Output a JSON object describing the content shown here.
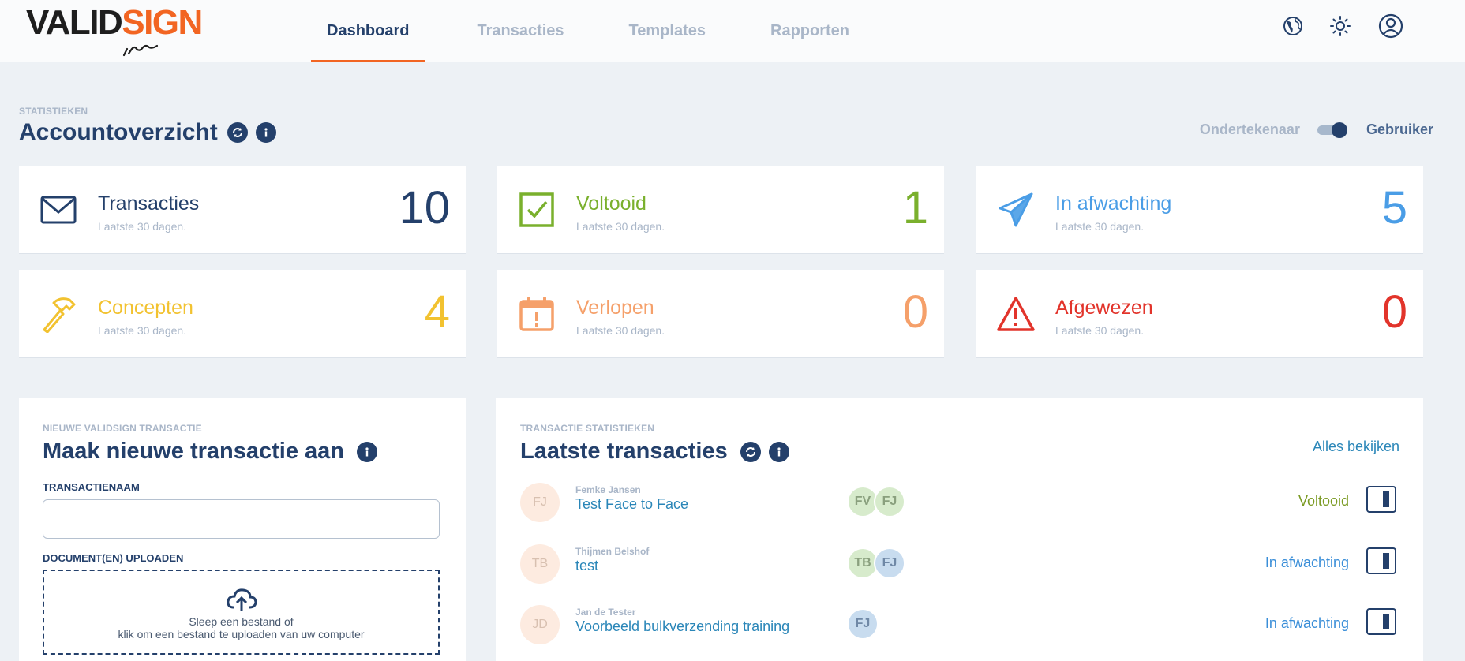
{
  "header": {
    "logo_left": "VALID",
    "logo_right": "SIGN",
    "tabs": [
      {
        "label": "Dashboard",
        "active": true
      },
      {
        "label": "Transacties",
        "active": false
      },
      {
        "label": "Templates",
        "active": false
      },
      {
        "label": "Rapporten",
        "active": false
      }
    ],
    "icons": [
      "globe-icon",
      "sun-icon",
      "user-icon"
    ]
  },
  "overview": {
    "eyebrow": "STATISTIEKEN",
    "title": "Accountoverzicht",
    "toggle": {
      "left_label": "Ondertekenaar",
      "right_label": "Gebruiker",
      "state": "right"
    }
  },
  "stats": [
    {
      "name": "Transacties",
      "sub": "Laatste 30 dagen.",
      "value": "10",
      "color": "#24406b",
      "icon": "envelope-icon"
    },
    {
      "name": "Voltooid",
      "sub": "Laatste 30 dagen.",
      "value": "1",
      "color": "#7ab02d",
      "icon": "checkbox-icon"
    },
    {
      "name": "In afwachting",
      "sub": "Laatste 30 dagen.",
      "value": "5",
      "color": "#4a9de6",
      "icon": "paper-plane-icon"
    },
    {
      "name": "Concepten",
      "sub": "Laatste 30 dagen.",
      "value": "4",
      "color": "#f2c230",
      "icon": "hammer-icon"
    },
    {
      "name": "Verlopen",
      "sub": "Laatste 30 dagen.",
      "value": "0",
      "color": "#f5a06a",
      "icon": "calendar-alert-icon"
    },
    {
      "name": "Afgewezen",
      "sub": "Laatste 30 dagen.",
      "value": "0",
      "color": "#e2342b",
      "icon": "warning-icon"
    }
  ],
  "new_tx": {
    "eyebrow": "NIEUWE VALIDSIGN TRANSACTIE",
    "title": "Maak nieuwe transactie aan",
    "name_label": "TRANSACTIENAAM",
    "name_value": "",
    "upload_label": "DOCUMENT(EN) UPLOADEN",
    "drop_line1": "Sleep een bestand of",
    "drop_line2": "klik om een bestand te uploaden van uw computer"
  },
  "latest": {
    "eyebrow": "TRANSACTIE STATISTIEKEN",
    "title": "Laatste transacties",
    "view_all": "Alles bekijken",
    "rows": [
      {
        "initials": "FJ",
        "owner": "Femke Jansen",
        "name": "Test Face to Face",
        "signers": [
          {
            "initials": "FV",
            "tone": "green"
          },
          {
            "initials": "FJ",
            "tone": "green"
          }
        ],
        "status": "Voltooid",
        "status_color": "#7a9a22"
      },
      {
        "initials": "TB",
        "owner": "Thijmen Belshof",
        "name": "test",
        "signers": [
          {
            "initials": "TB",
            "tone": "green"
          },
          {
            "initials": "FJ",
            "tone": "blue"
          }
        ],
        "status": "In afwachting",
        "status_color": "#3a8ed8"
      },
      {
        "initials": "JD",
        "owner": "Jan de Tester",
        "name": "Voorbeeld bulkverzending training",
        "signers": [
          {
            "initials": "FJ",
            "tone": "blue"
          }
        ],
        "status": "In afwachting",
        "status_color": "#3a8ed8"
      }
    ]
  }
}
